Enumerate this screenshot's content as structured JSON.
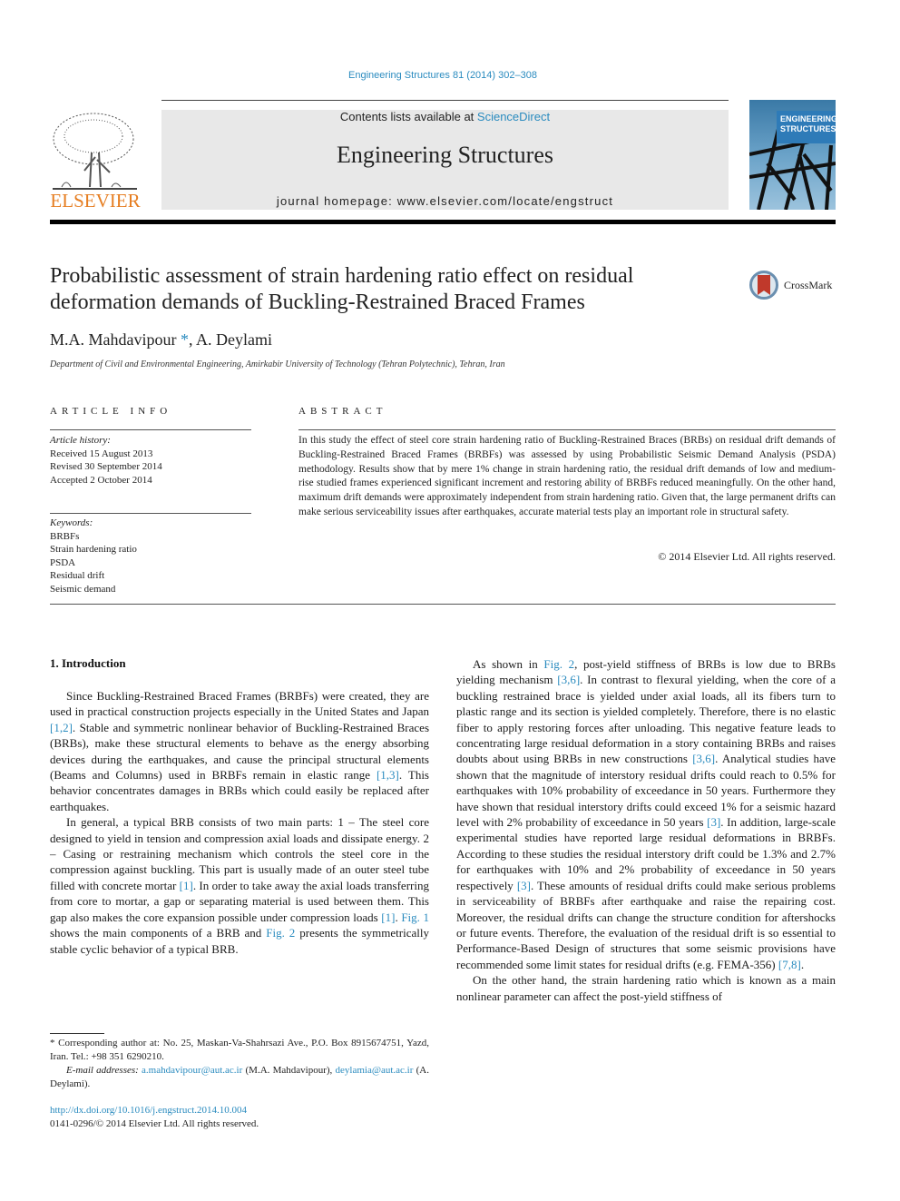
{
  "header": {
    "journal_ref": "Engineering Structures 81 (2014) 302–308",
    "contents_prefix": "Contents lists available at ",
    "contents_link": "ScienceDirect",
    "journal_title": "Engineering Structures",
    "homepage": "journal homepage: www.elsevier.com/locate/engstruct",
    "publisher_logo_text": "ELSEVIER",
    "cover_title_line1": "ENGINEERING",
    "cover_title_line2": "STRUCTURES",
    "crossmark_label": "CrossMark"
  },
  "article": {
    "title": "Probabilistic assessment of strain hardening ratio effect on residual deformation demands of Buckling-Restrained Braced Frames",
    "author1": "M.A. Mahdavipour",
    "author_marker": "*",
    "author_sep": ", ",
    "author2": "A. Deylami",
    "affiliation": "Department of Civil and Environmental Engineering, Amirkabir University of Technology (Tehran Polytechnic), Tehran, Iran"
  },
  "article_info": {
    "heading": "ARTICLE INFO",
    "history_label": "Article history:",
    "history": [
      "Received 15 August 2013",
      "Revised 30 September 2014",
      "Accepted 2 October 2014"
    ],
    "keywords_label": "Keywords:",
    "keywords": [
      "BRBFs",
      "Strain hardening ratio",
      "PSDA",
      "Residual drift",
      "Seismic demand"
    ]
  },
  "abstract": {
    "heading": "ABSTRACT",
    "text": "In this study the effect of steel core strain hardening ratio of Buckling-Restrained Braces (BRBs) on residual drift demands of Buckling-Restrained Braced Frames (BRBFs) was assessed by using Probabilistic Seismic Demand Analysis (PSDA) methodology. Results show that by mere 1% change in strain hardening ratio, the residual drift demands of low and medium-rise studied frames experienced significant increment and restoring ability of BRBFs reduced meaningfully. On the other hand, maximum drift demands were approximately independent from strain hardening ratio. Given that, the large permanent drifts can make serious serviceability issues after earthquakes, accurate material tests play an important role in structural safety.",
    "copyright": "© 2014 Elsevier Ltd. All rights reserved."
  },
  "body": {
    "section_heading": "1. Introduction",
    "p1": {
      "t1": "Since Buckling-Restrained Braced Frames (BRBFs) were created, they are used in practical construction projects especially in the United States and Japan ",
      "c1": "[1,2]",
      "t2": ". Stable and symmetric nonlinear behavior of Buckling-Restrained Braces (BRBs), make these structural elements to behave as the energy absorbing devices during the earthquakes, and cause the principal structural elements (Beams and Columns) used in BRBFs remain in elastic range ",
      "c2": "[1,3]",
      "t3": ". This behavior concentrates damages in BRBs which could easily be replaced after earthquakes."
    },
    "p2": {
      "t1": "In general, a typical BRB consists of two main parts: 1 – The steel core designed to yield in tension and compression axial loads and dissipate energy. 2 – Casing or restraining mechanism which controls the steel core in the compression against buckling. This part is usually made of an outer steel tube filled with concrete mortar ",
      "c1": "[1]",
      "t2": ". In order to take away the axial loads transferring from core to mortar, a gap or separating material is used between them. This gap also makes the core expansion possible under compression loads ",
      "c2": "[1]",
      "t3": ". ",
      "c3": "Fig. 1",
      "t4": " shows the main components of a BRB and ",
      "c4": "Fig. 2",
      "t5": " presents the symmetrically stable cyclic behavior of a typical BRB."
    },
    "p3": {
      "t1": "As shown in ",
      "c1": "Fig. 2",
      "t2": ", post-yield stiffness of BRBs is low due to BRBs yielding mechanism ",
      "c2": "[3,6]",
      "t3": ". In contrast to flexural yielding, when the core of a buckling restrained brace is yielded under axial loads, all its fibers turn to plastic range and its section is yielded completely. Therefore, there is no elastic fiber to apply restoring forces after unloading. This negative feature leads to concentrating large residual deformation in a story containing BRBs and raises doubts about using BRBs in new constructions ",
      "c3": "[3,6]",
      "t4": ". Analytical studies have shown that the magnitude of interstory residual drifts could reach to 0.5% for earthquakes with 10% probability of exceedance in 50 years. Furthermore they have shown that residual interstory drifts could exceed 1% for a seismic hazard level with 2% probability of exceedance in 50 years ",
      "c4": "[3]",
      "t5": ". In addition, large-scale experimental studies have reported large residual deformations in BRBFs. According to these studies the residual interstory drift could be 1.3% and 2.7% for earthquakes with 10% and 2% probability of exceedance in 50 years respectively ",
      "c5": "[3]",
      "t6": ". These amounts of residual drifts could make serious problems in serviceability of BRBFs after earthquake and raise the repairing cost. Moreover, the residual drifts can change the structure condition for aftershocks or future events. Therefore, the evaluation of the residual drift is so essential to Performance-Based Design of structures that some seismic provisions have recommended some limit states for residual drifts (e.g. FEMA-356) ",
      "c6": "[7,8]",
      "t7": "."
    },
    "p4": {
      "t1": "On the other hand, the strain hardening ratio which is known as a main nonlinear parameter can affect the post-yield stiffness of"
    }
  },
  "footnotes": {
    "corresponding": "* Corresponding author at: No. 25, Maskan-Va-Shahrsazi Ave., P.O. Box 8915674751, Yazd, Iran. Tel.: +98 351 6290210.",
    "email_label": "E-mail addresses: ",
    "email1": "a.mahdavipour@aut.ac.ir",
    "email1_name": " (M.A. Mahdavipour), ",
    "email2": "deylamia@aut.ac.ir",
    "email2_name": " (A. Deylami).",
    "doi": "http://dx.doi.org/10.1016/j.engstruct.2014.10.004",
    "issn": "0141-0296/© 2014 Elsevier Ltd. All rights reserved."
  }
}
